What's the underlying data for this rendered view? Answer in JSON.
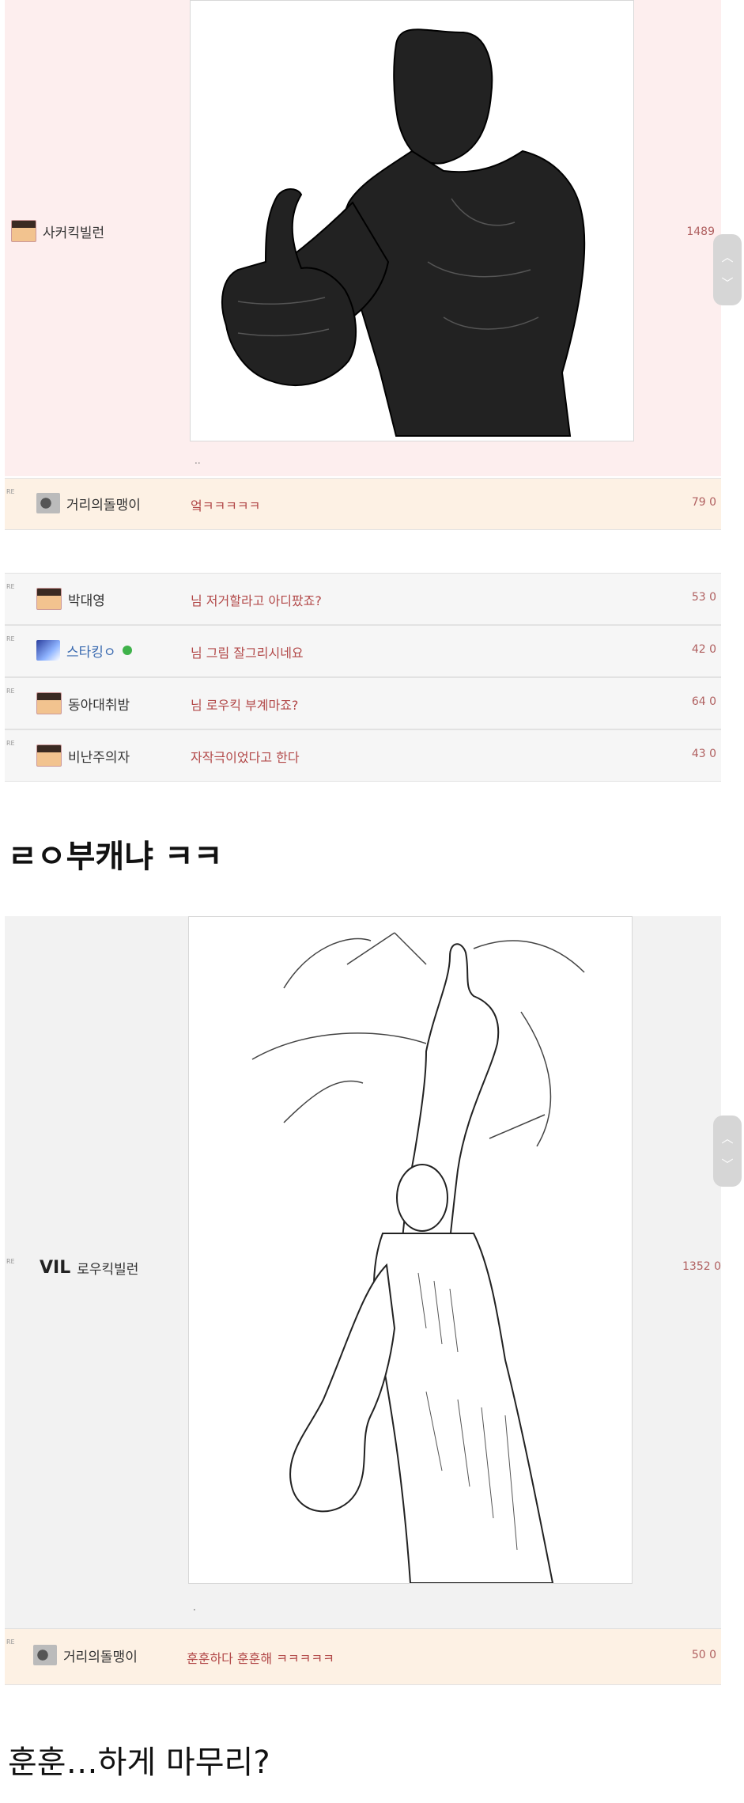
{
  "thread1": {
    "author": "사커킥빌런",
    "count": "1489",
    "dot": "..",
    "replies": [
      {
        "name": "거리의돌맹이",
        "msg": "엌ㅋㅋㅋㅋㅋ",
        "count": "79 0",
        "avatar": "cat-avatar",
        "highlight": true
      },
      {
        "name": "박대영",
        "msg": "님 저거할라고 아디팠죠?",
        "count": "53 0",
        "avatar": "man-avatar",
        "highlight": false
      },
      {
        "name": "스타킹ㅇ",
        "msg": "님 그림 잘그리시네요",
        "count": "42 0",
        "avatar": "anime-avatar",
        "highlight": false
      },
      {
        "name": "동아대취밤",
        "msg": "님 로우킥 부계마죠?",
        "count": "64 0",
        "avatar": "man-avatar",
        "highlight": false
      },
      {
        "name": "비난주의자",
        "msg": "자작극이었다고 한다",
        "count": "43 0",
        "avatar": "man-avatar",
        "highlight": false
      }
    ]
  },
  "caption1": "ㄹㅇ부캐냐 ㅋㅋ",
  "thread2": {
    "author_prefix": "VIL",
    "author": "로우킥빌런",
    "count": "1352 0",
    "dot": "·",
    "reply": {
      "name": "거리의돌맹이",
      "msg": "훈훈하다 훈훈해 ㅋㅋㅋㅋㅋ",
      "count": "50 0"
    }
  },
  "caption2": "훈훈…하게 마무리?",
  "re_label": "RE",
  "colors": {
    "pink_bg": "#fdeeee",
    "reply_highlight": "#fdf1e4",
    "msg_red": "#b24848"
  }
}
